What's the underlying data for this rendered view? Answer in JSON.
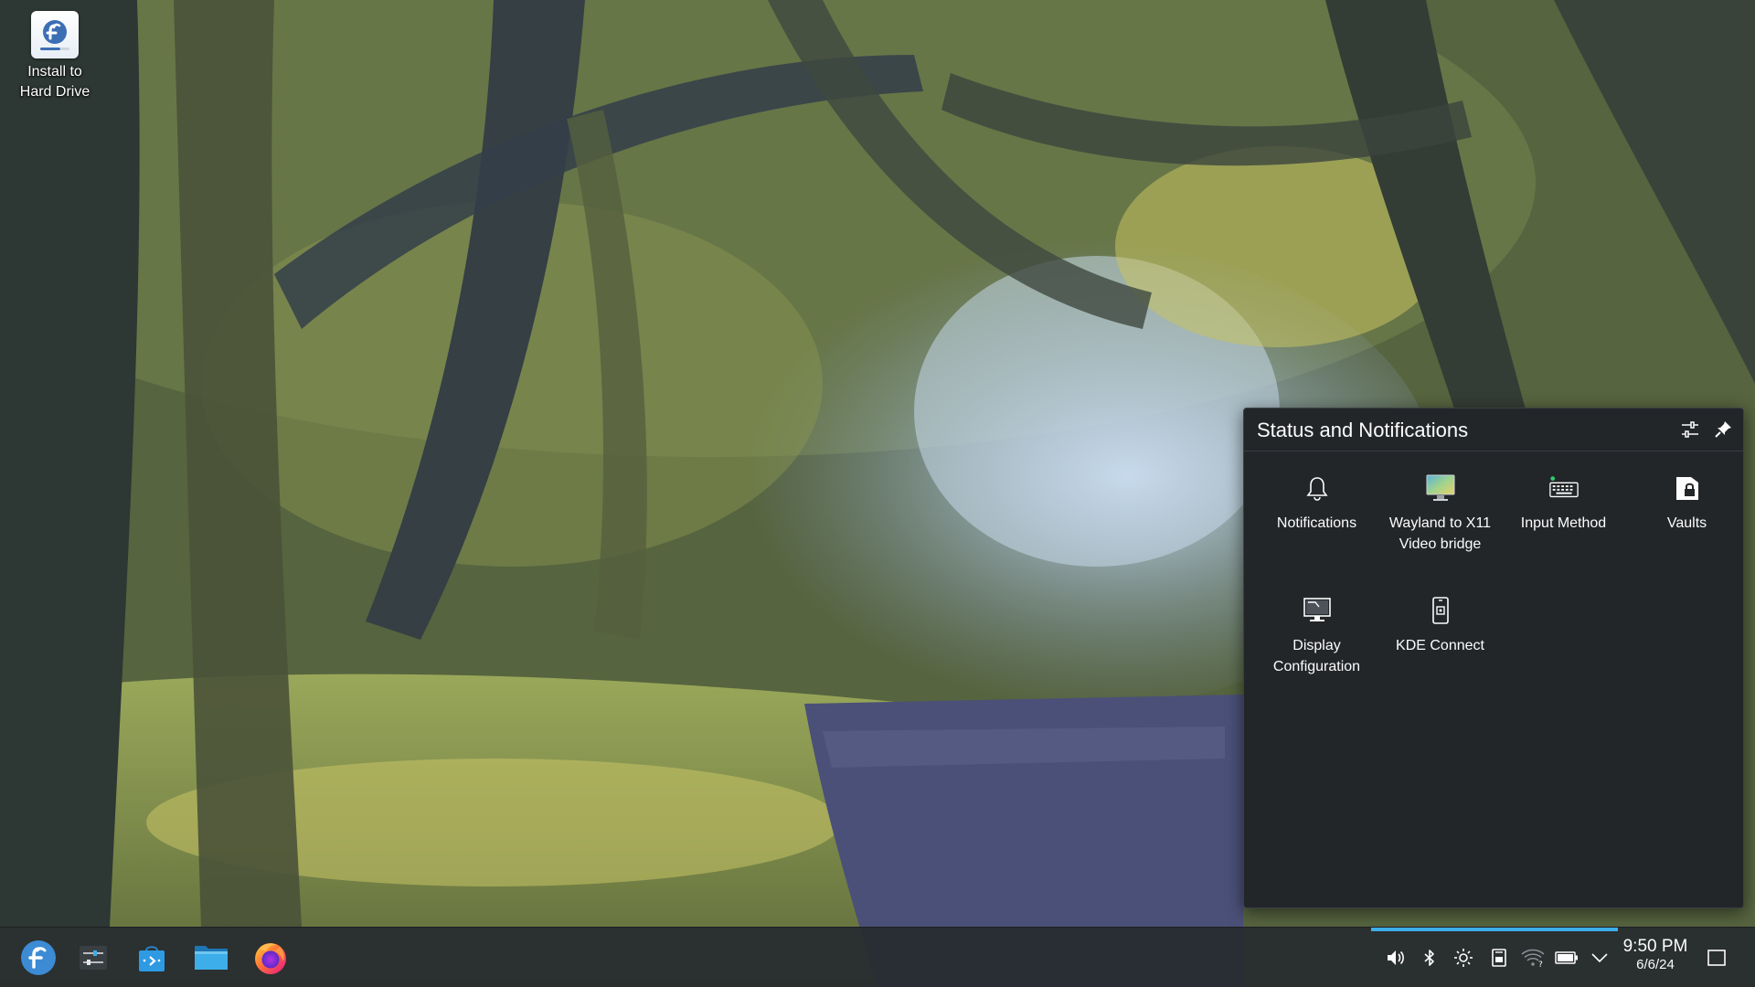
{
  "desktop": {
    "icons": [
      {
        "label_line1": "Install to",
        "label_line2": "Hard Drive",
        "icon": "fedora-installer-icon"
      }
    ]
  },
  "popup": {
    "title": "Status and Notifications",
    "header_buttons": [
      "configure-icon",
      "pin-icon"
    ],
    "applets": [
      {
        "label": "Notifications",
        "icon": "bell-icon"
      },
      {
        "label": "Wayland to X11 Video bridge",
        "icon": "video-bridge-icon"
      },
      {
        "label": "Input Method",
        "icon": "keyboard-icon"
      },
      {
        "label": "Vaults",
        "icon": "vault-lock-icon"
      },
      {
        "label": "Display Configuration",
        "icon": "monitor-icon"
      },
      {
        "label": "KDE Connect",
        "icon": "phone-icon"
      }
    ]
  },
  "taskbar": {
    "launchers": [
      "fedora-launcher-icon",
      "system-settings-icon",
      "discover-icon",
      "file-manager-icon",
      "firefox-icon"
    ],
    "tray": [
      "volume-icon",
      "bluetooth-icon",
      "brightness-icon",
      "storage-icon",
      "wifi-icon",
      "battery-icon",
      "chevron-down-icon"
    ],
    "clock": {
      "time": "9:50 PM",
      "date": "6/6/24"
    }
  },
  "colors": {
    "accent": "#3daee9",
    "panel_bg": "#232629",
    "taskbar_bg": "#272b2f",
    "text": "#fcfcfc"
  }
}
